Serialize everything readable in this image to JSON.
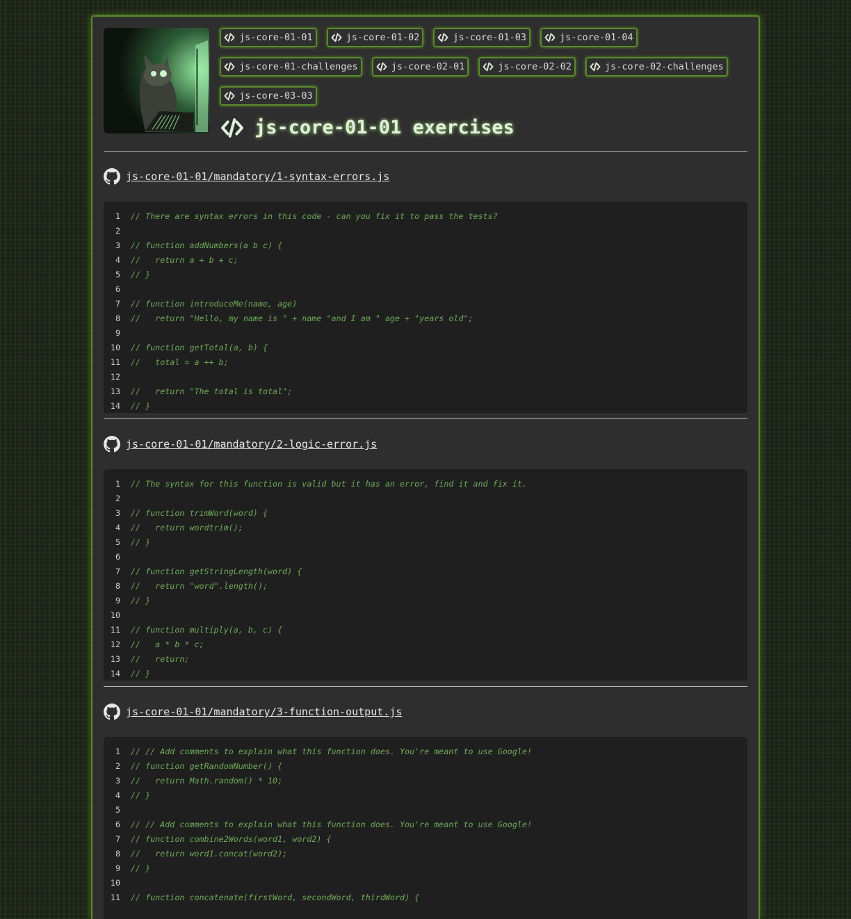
{
  "header": {
    "links": [
      "js-core-01-01",
      "js-core-01-02",
      "js-core-01-03",
      "js-core-01-04",
      "js-core-01-challenges",
      "js-core-02-01",
      "js-core-02-02",
      "js-core-02-challenges",
      "js-core-03-03"
    ],
    "title": "js-core-01-01 exercises"
  },
  "files": [
    {
      "path": "js-core-01-01/mandatory/1-syntax-errors.js",
      "lines": [
        "// There are syntax errors in this code - can you fix it to pass the tests?",
        "",
        "// function addNumbers(a b c) {",
        "//   return a + b + c;",
        "// }",
        "",
        "// function introduceMe(name, age)",
        "//   return \"Hello, my name is \" + name \"and I am \" age + \"years old\";",
        "",
        "// function getTotal(a, b) {",
        "//   total = a ++ b;",
        "",
        "//   return \"The total is total\";",
        "// }"
      ]
    },
    {
      "path": "js-core-01-01/mandatory/2-logic-error.js",
      "lines": [
        "// The syntax for this function is valid but it has an error, find it and fix it.",
        "",
        "// function trimWord(word) {",
        "//   return wordtrim();",
        "// }",
        "",
        "// function getStringLength(word) {",
        "//   return \"word\".length();",
        "// }",
        "",
        "// function multiply(a, b, c) {",
        "//   a * b * c;",
        "//   return;",
        "// }"
      ]
    },
    {
      "path": "js-core-01-01/mandatory/3-function-output.js",
      "lines": [
        "// // Add comments to explain what this function does. You're meant to use Google!",
        "// function getRandomNumber() {",
        "//   return Math.random() * 10;",
        "// }",
        "",
        "// // Add comments to explain what this function does. You're meant to use Google!",
        "// function combine2Words(word1, word2) {",
        "//   return word1.concat(word2);",
        "// }",
        "",
        "// function concatenate(firstWord, secondWord, thirdWord) {"
      ]
    }
  ],
  "icons": {
    "chip": "code-icon",
    "title": "code-icon",
    "file": "github-icon",
    "avatar": "cat-hacker-avatar"
  },
  "colors": {
    "accent": "#5b8a2a",
    "code_bg": "#1f1f1f",
    "comment": "#6faa5a",
    "panel": "#2e2e2e"
  }
}
